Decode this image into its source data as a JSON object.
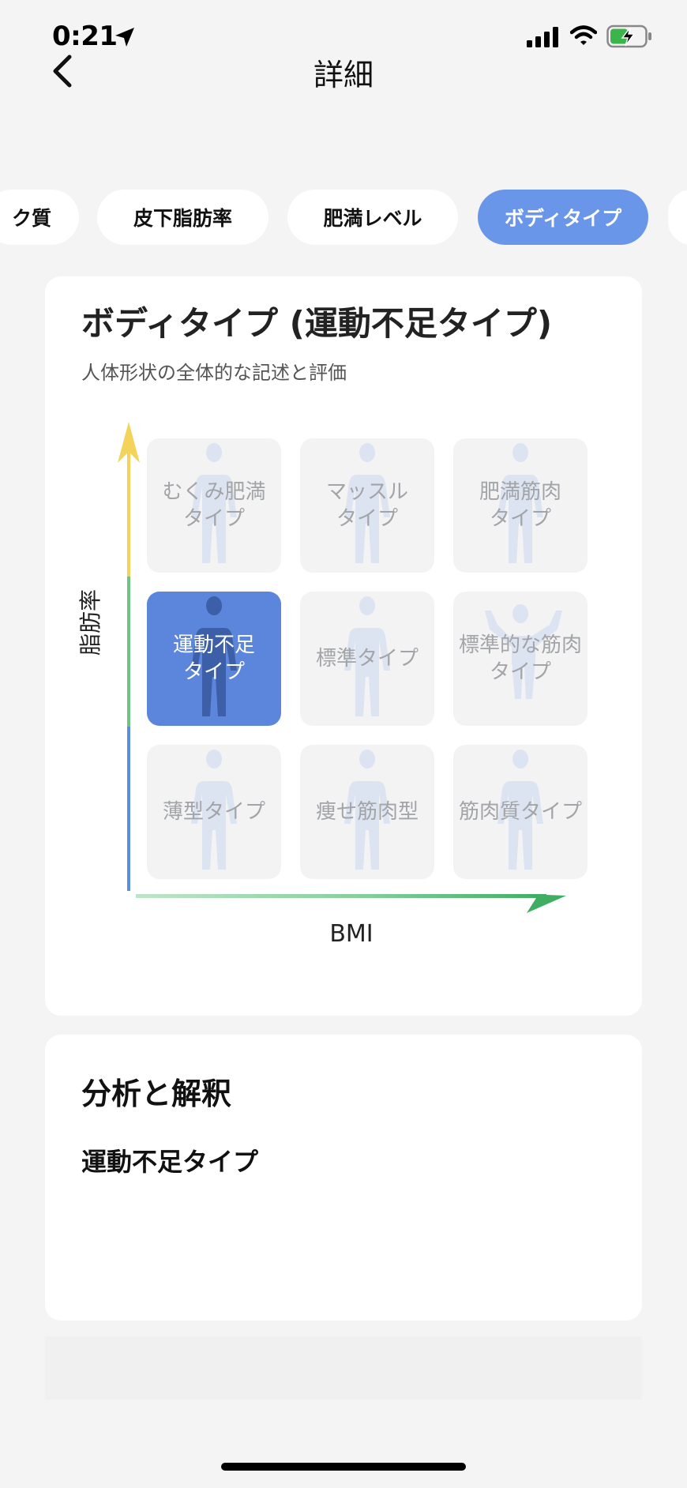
{
  "status_bar": {
    "time": "0:21",
    "icons": [
      "location-arrow-icon",
      "cellular-signal-icon",
      "wifi-icon",
      "battery-charging-icon"
    ]
  },
  "nav": {
    "back_icon": "chevron-left-icon",
    "title": "詳細"
  },
  "tabs": [
    {
      "label": "ク質",
      "active": false
    },
    {
      "label": "皮下脂肪率",
      "active": false
    },
    {
      "label": "肥満レベル",
      "active": false
    },
    {
      "label": "ボディタイプ",
      "active": true
    }
  ],
  "body_type_card": {
    "title": "ボディタイプ (運動不足タイプ)",
    "subtitle": "人体形状の全体的な記述と評価",
    "y_axis_label": "脂肪率",
    "x_axis_label": "BMI",
    "grid": [
      {
        "label": "むくみ肥満\nタイプ",
        "active": false,
        "figure": "person-silhouette-icon"
      },
      {
        "label": "マッスル\nタイプ",
        "active": false,
        "figure": "person-silhouette-icon"
      },
      {
        "label": "肥満筋肉\nタイプ",
        "active": false,
        "figure": "person-silhouette-icon"
      },
      {
        "label": "運動不足\nタイプ",
        "active": true,
        "figure": "person-silhouette-icon"
      },
      {
        "label": "標準タイプ",
        "active": false,
        "figure": "person-silhouette-icon"
      },
      {
        "label": "標準的な筋肉\nタイプ",
        "active": false,
        "figure": "flexing-person-icon"
      },
      {
        "label": "薄型タイプ",
        "active": false,
        "figure": "person-silhouette-icon"
      },
      {
        "label": "痩せ筋肉型",
        "active": false,
        "figure": "person-silhouette-icon"
      },
      {
        "label": "筋肉質タイプ",
        "active": false,
        "figure": "person-silhouette-icon"
      }
    ],
    "colors": {
      "active_cell": "#5b86db",
      "inactive_cell": "#f3f3f4",
      "y_axis_top": "#f3d35a",
      "y_axis_mid": "#6dc483",
      "y_axis_bottom": "#5b8ee0",
      "x_axis_light": "#9fd8ad",
      "x_axis_dark": "#3fae62"
    }
  },
  "analysis_card": {
    "title": "分析と解釈",
    "type_name": "運動不足タイプ"
  }
}
